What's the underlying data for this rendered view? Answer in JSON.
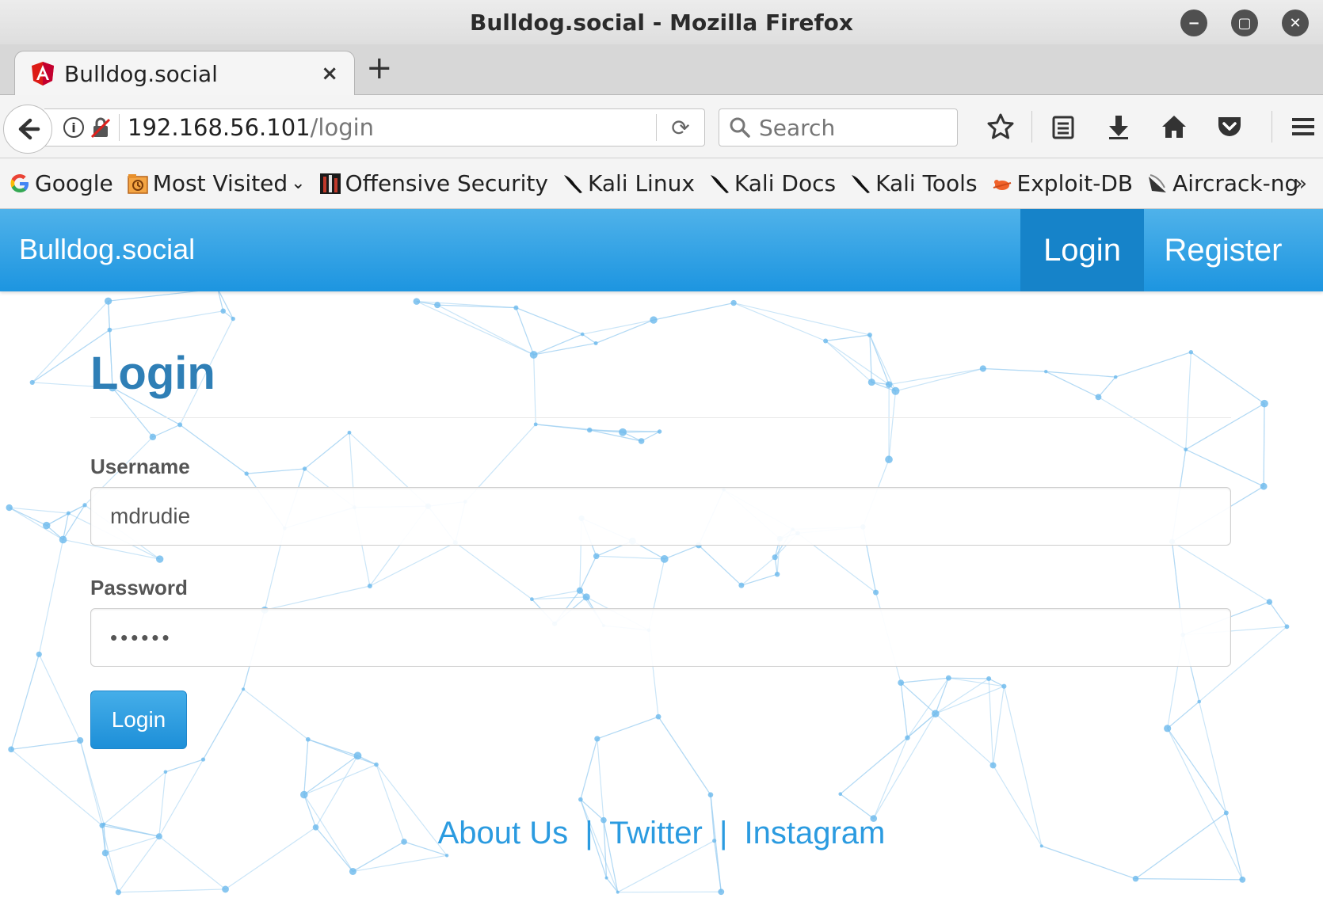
{
  "window": {
    "title": "Bulldog.social - Mozilla Firefox"
  },
  "tab": {
    "title": "Bulldog.social",
    "close": "×",
    "new_tab": "+"
  },
  "navbar": {
    "url_host": "192.168.56.101",
    "url_path": "/login",
    "search_placeholder": "Search"
  },
  "bookmarks": [
    {
      "label": "Google",
      "icon": "google-icon"
    },
    {
      "label": "Most Visited",
      "icon": "most-visited-icon"
    },
    {
      "label": "Offensive Security",
      "icon": "offsec-icon"
    },
    {
      "label": "Kali Linux",
      "icon": "kali-icon"
    },
    {
      "label": "Kali Docs",
      "icon": "kali-icon"
    },
    {
      "label": "Kali Tools",
      "icon": "kali-icon"
    },
    {
      "label": "Exploit-DB",
      "icon": "exploitdb-icon"
    },
    {
      "label": "Aircrack-ng",
      "icon": "aircrack-icon"
    }
  ],
  "bookmarks_more": "»",
  "site": {
    "brand": "Bulldog.social",
    "nav_login": "Login",
    "nav_register": "Register",
    "heading": "Login",
    "username_label": "Username",
    "username_value": "mdrudie",
    "password_label": "Password",
    "password_value": "••••••",
    "submit": "Login",
    "footer": {
      "about": "About Us",
      "sep": "|",
      "twitter": "Twitter",
      "instagram": "Instagram"
    }
  },
  "colors": {
    "nav_top": "#4fb2ea",
    "nav_bottom": "#1d95e0",
    "heading": "#2f7fb6",
    "link": "#2b9be0"
  }
}
